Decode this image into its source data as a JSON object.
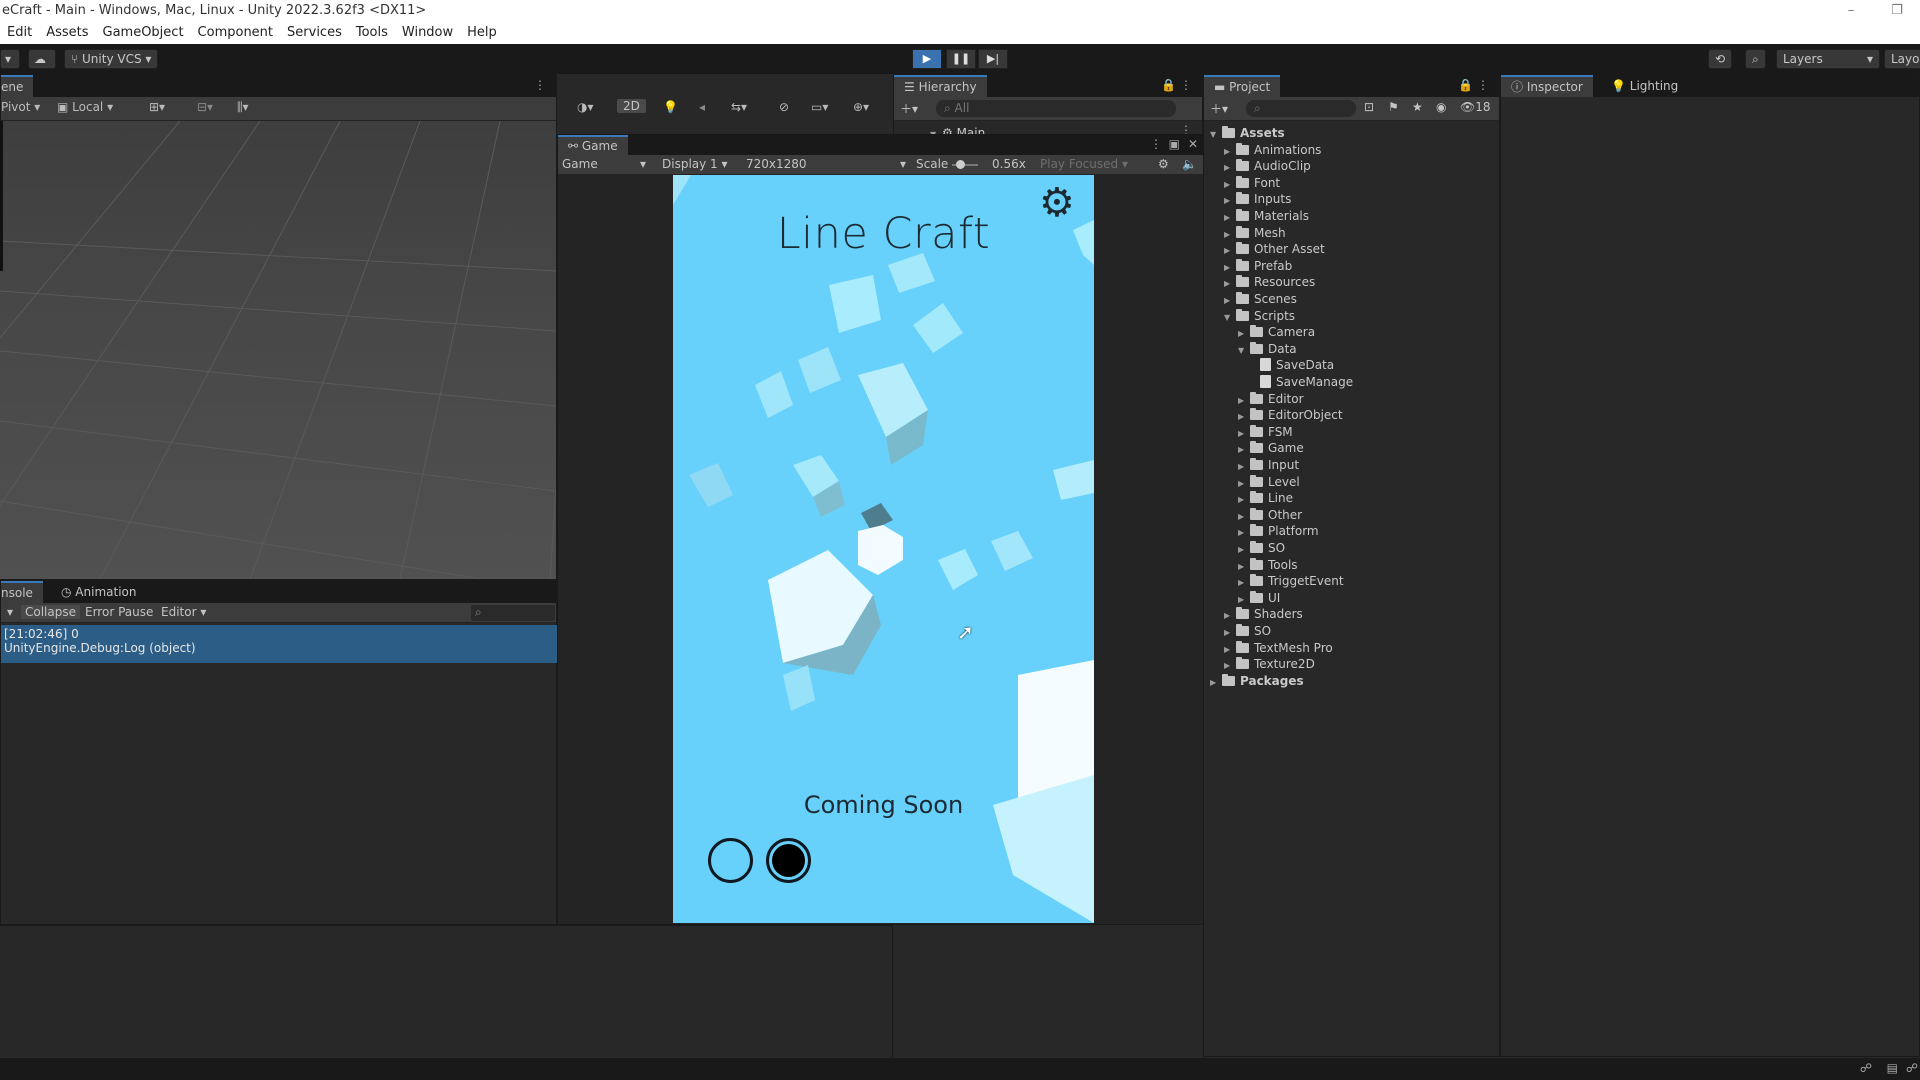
{
  "window": {
    "title": "eCraft - Main - Windows, Mac, Linux - Unity 2022.3.62f3 <DX11>",
    "controls": [
      "–",
      "❐"
    ]
  },
  "menu": [
    "Edit",
    "Assets",
    "GameObject",
    "Component",
    "Services",
    "Tools",
    "Window",
    "Help"
  ],
  "toolbar": {
    "vcs_label": "Unity VCS",
    "layers_label": "Layers",
    "layout_label": "Layout"
  },
  "scene": {
    "tab_label": "ene",
    "pivot_label": "Pivot",
    "local_label": "Local",
    "mode_2d": "2D"
  },
  "console": {
    "tab_label": "nsole",
    "animation_tab": "Animation",
    "collapse": "Collapse",
    "error_pause": "Error Pause",
    "editor": "Editor",
    "log_time": "[21:02:46] 0",
    "log_detail": "UnityEngine.Debug:Log (object)"
  },
  "hierarchy": {
    "tab_label": "Hierarchy",
    "search_placeholder": "All",
    "root": "Main"
  },
  "game": {
    "tab_label": "Game",
    "mode": "Game",
    "display": "Display 1",
    "resolution": "720x1280",
    "scale_label": "Scale",
    "scale_value": "0.56x",
    "play_focused": "Play Focused",
    "title": "Line Craft",
    "coming_soon": "Coming Soon"
  },
  "project": {
    "tab_label": "Project",
    "count": "18",
    "root": "Assets",
    "packages": "Packages",
    "items": [
      {
        "label": "Animations",
        "depth": 1,
        "type": "folder",
        "expanded": false
      },
      {
        "label": "AudioClip",
        "depth": 1,
        "type": "folder",
        "expanded": false
      },
      {
        "label": "Font",
        "depth": 1,
        "type": "folder",
        "expanded": false
      },
      {
        "label": "Inputs",
        "depth": 1,
        "type": "folder",
        "expanded": false
      },
      {
        "label": "Materials",
        "depth": 1,
        "type": "folder",
        "expanded": false
      },
      {
        "label": "Mesh",
        "depth": 1,
        "type": "folder",
        "expanded": false
      },
      {
        "label": "Other Asset",
        "depth": 1,
        "type": "folder",
        "expanded": false
      },
      {
        "label": "Prefab",
        "depth": 1,
        "type": "folder",
        "expanded": false
      },
      {
        "label": "Resources",
        "depth": 1,
        "type": "folder",
        "expanded": false
      },
      {
        "label": "Scenes",
        "depth": 1,
        "type": "folder",
        "expanded": false
      },
      {
        "label": "Scripts",
        "depth": 1,
        "type": "folder",
        "expanded": true
      },
      {
        "label": "Camera",
        "depth": 2,
        "type": "folder",
        "expanded": false
      },
      {
        "label": "Data",
        "depth": 2,
        "type": "folder",
        "expanded": true
      },
      {
        "label": "SaveData",
        "depth": 3,
        "type": "script"
      },
      {
        "label": "SaveManage",
        "depth": 3,
        "type": "script"
      },
      {
        "label": "Editor",
        "depth": 2,
        "type": "folder",
        "expanded": false
      },
      {
        "label": "EditorObject",
        "depth": 2,
        "type": "folder",
        "expanded": false
      },
      {
        "label": "FSM",
        "depth": 2,
        "type": "folder",
        "expanded": false
      },
      {
        "label": "Game",
        "depth": 2,
        "type": "folder",
        "expanded": false
      },
      {
        "label": "Input",
        "depth": 2,
        "type": "folder",
        "expanded": false
      },
      {
        "label": "Level",
        "depth": 2,
        "type": "folder",
        "expanded": false
      },
      {
        "label": "Line",
        "depth": 2,
        "type": "folder",
        "expanded": false
      },
      {
        "label": "Other",
        "depth": 2,
        "type": "folder",
        "expanded": false
      },
      {
        "label": "Platform",
        "depth": 2,
        "type": "folder",
        "expanded": false
      },
      {
        "label": "SO",
        "depth": 2,
        "type": "folder",
        "expanded": false
      },
      {
        "label": "Tools",
        "depth": 2,
        "type": "folder",
        "expanded": false
      },
      {
        "label": "TriggetEvent",
        "depth": 2,
        "type": "folder",
        "expanded": false
      },
      {
        "label": "UI",
        "depth": 2,
        "type": "folder",
        "expanded": false
      },
      {
        "label": "Shaders",
        "depth": 1,
        "type": "folder",
        "expanded": false
      },
      {
        "label": "SO",
        "depth": 1,
        "type": "folder",
        "expanded": false
      },
      {
        "label": "TextMesh Pro",
        "depth": 1,
        "type": "folder",
        "expanded": false
      },
      {
        "label": "Texture2D",
        "depth": 1,
        "type": "folder",
        "expanded": false
      }
    ]
  },
  "inspector": {
    "tab_label": "Inspector",
    "lighting_tab": "Lighting"
  },
  "colors": {
    "game_bg": "#67d1fb",
    "accent": "#3a79bb",
    "log_row": "#2c5d87"
  }
}
